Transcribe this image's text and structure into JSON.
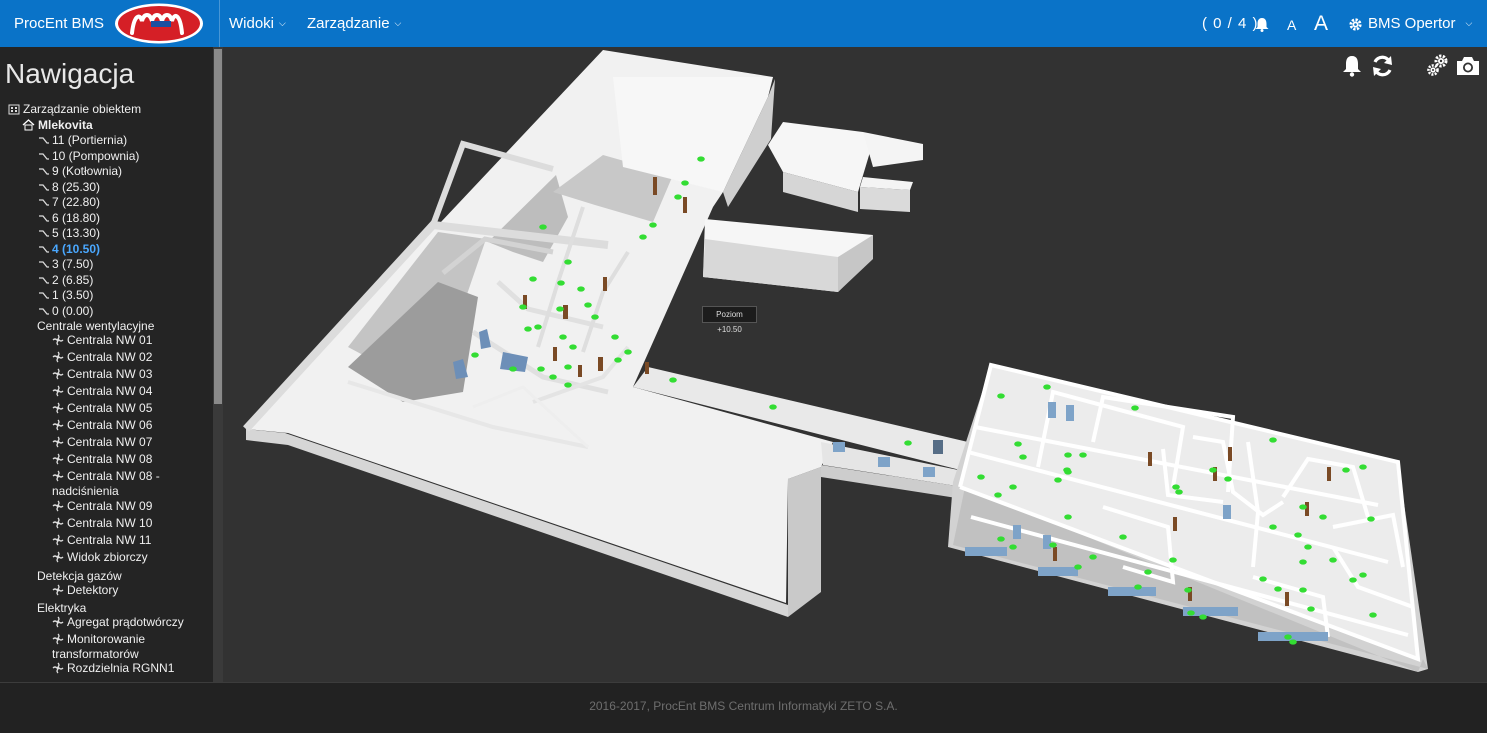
{
  "navbar": {
    "brand": "ProcEnt BMS",
    "logo_alt": "Mlekovita",
    "menus": [
      {
        "label": "Widoki"
      },
      {
        "label": "Zarządzanie"
      }
    ],
    "alarm_count": "( 0 / 4 )",
    "font_small": "A",
    "font_large": "A",
    "user": "BMS Opertor"
  },
  "sidebar": {
    "title": "Nawigacja",
    "root": "Zarządzanie obiektem",
    "site": "Mlekovita",
    "levels": [
      "11 (Portiernia)",
      "10 (Pompownia)",
      "9 (Kotłownia)",
      "8 (25.30)",
      "7 (22.80)",
      "6 (18.80)",
      "5 (13.30)",
      "4 (10.50)",
      "3 (7.50)",
      "2 (6.85)",
      "1 (3.50)",
      "0 (0.00)"
    ],
    "groups": {
      "ventilation": "Centrale wentylacyjne",
      "ventilation_items": [
        "Centrala NW 01",
        "Centrala NW 02",
        "Centrala NW 03",
        "Centrala NW 04",
        "Centrala NW 05",
        "Centrala NW 06",
        "Centrala NW 07",
        "Centrala NW 08",
        "Centrala NW 08 -",
        "nadciśnienia",
        "Centrala NW 09",
        "Centrala NW 10",
        "Centrala NW 11",
        "Widok zbiorczy"
      ],
      "gas": "Detekcja gazów",
      "gas_items": [
        "Detektory"
      ],
      "electric": "Elektryka",
      "electric_items": [
        "Agregat prądotwórczy",
        "Monitorowanie",
        "transformatorów",
        "Rozdzielnia RGNN1"
      ]
    }
  },
  "viewport": {
    "tooltip": "Poziom +10.50",
    "icons": [
      "bell-icon",
      "refresh-icon",
      "settings-icon",
      "camera-icon"
    ]
  },
  "footer": {
    "text": "2016-2017, ProcEnt BMS Centrum Informatyki ZETO S.A."
  },
  "colors": {
    "navbar": "#0a73c8",
    "sidebar": "#242424",
    "viewport": "#323232",
    "active_level": "#4aa8ff",
    "sensor": "#33dd33"
  }
}
